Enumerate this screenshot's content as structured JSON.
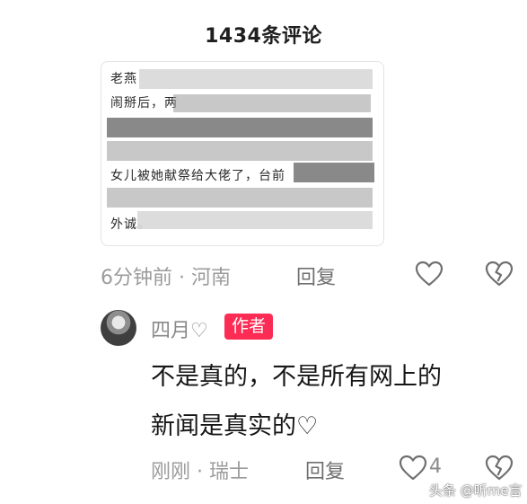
{
  "header": {
    "title": "1434条评论"
  },
  "screenshot_card": {
    "visible_lines": [
      "老燕",
      "闹掰后，两",
      "",
      "",
      "女儿被她献祭给大佬了，台前",
      "",
      "外诚。"
    ]
  },
  "comment_1": {
    "meta": "6分钟前 · 河南",
    "reply_label": "回复",
    "like_icon": "heart-outline-icon",
    "dislike_icon": "broken-heart-icon"
  },
  "comment_2": {
    "author": "四月♡",
    "badge": "作者",
    "text_line_1": "不是真的，不是所有网上的",
    "text_line_2": "新闻是真实的♡",
    "meta": "刚刚 · 瑞士",
    "reply_label": "回复",
    "like_count": "4",
    "like_icon": "heart-outline-icon",
    "dislike_icon": "broken-heart-icon"
  },
  "watermark": "头条 @听me言"
}
